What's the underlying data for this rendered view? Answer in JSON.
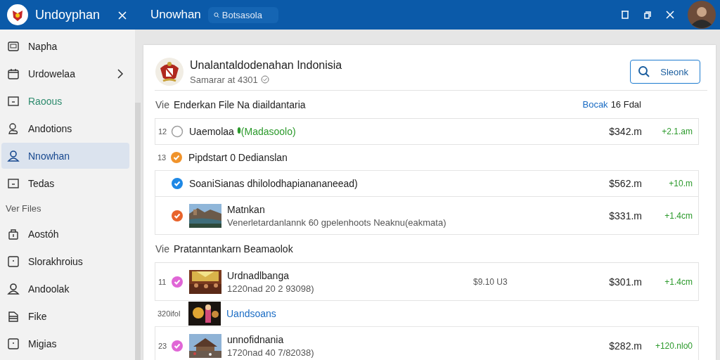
{
  "topbar": {
    "app_title": "Undoyphan",
    "section_title": "Unowhan",
    "search": {
      "placeholder": "Botsasola"
    }
  },
  "sidebar": {
    "items": [
      {
        "label": "Napha",
        "selected": false,
        "chevron": false
      },
      {
        "label": "Urdowelaa",
        "selected": false,
        "chevron": true
      },
      {
        "label": "Raoous",
        "selected": false,
        "chevron": false,
        "accent": true
      },
      {
        "label": "Andotions",
        "selected": false,
        "chevron": false
      },
      {
        "label": "Nnowhan",
        "selected": true,
        "chevron": false
      },
      {
        "label": "Tedas",
        "selected": false,
        "chevron": false
      }
    ],
    "section": "Ver Files",
    "items2": [
      {
        "label": "Aostóh",
        "selected": false,
        "chevron": false
      },
      {
        "label": "Slorakhroius",
        "selected": false,
        "chevron": false
      },
      {
        "label": "Andoolak",
        "selected": false,
        "chevron": false
      },
      {
        "label": "Fike",
        "selected": false,
        "chevron": false
      },
      {
        "label": "Migias",
        "selected": false,
        "chevron": false
      }
    ]
  },
  "card": {
    "title": "Unalantaldodenahan Indonisia",
    "subtitle": "Samarar at 4301",
    "button": "Sleonk",
    "sections": [
      {
        "prefix": "Vie",
        "title": "Enderkan File Na diaildantaria",
        "right_link": "Bocak",
        "right_text": "16 Fdal",
        "rows": [
          {
            "number": "12",
            "check": {
              "checked": false,
              "color": "#9e9e9e"
            },
            "title": "Uaemolaa",
            "tag": "(Madasoolo)",
            "price": "$342.m",
            "change": "+2.1.am",
            "boxed": true
          },
          {
            "number": "13",
            "check": {
              "checked": true,
              "color": "#f0932b"
            },
            "title": "Pipdstart 0 Dedianslan",
            "boxed": false
          },
          {
            "check": {
              "checked": true,
              "color": "#1e88e5"
            },
            "title": "SoaniSianas dhilolodhapianananeead)",
            "price": "$562.m",
            "change": "+10.m",
            "boxed": true
          },
          {
            "check": {
              "checked": true,
              "color": "#e8632b"
            },
            "title": "Matnkan",
            "subtitle": "Venerletardanlannk 60 gpelenhoots Neaknu(eakmata)",
            "price": "$331.m",
            "change": "+1.4cm",
            "boxed": true
          }
        ]
      },
      {
        "prefix": "Vie",
        "title": "Pratanntankarn Beamaolok",
        "rows": [
          {
            "number": "11",
            "check": {
              "checked": true,
              "color": "#e066d6"
            },
            "title": "Urdnadlbanga",
            "subtitle": "1220nad 20 2 93098)",
            "middle": "$9.10 U3",
            "price": "$301.m",
            "change": "+1.4cm",
            "boxed": true
          },
          {
            "number": "320ifol",
            "title": "Uandsoans",
            "link": true,
            "boxed": false
          },
          {
            "number": "23",
            "check": {
              "checked": true,
              "color": "#e066d6"
            },
            "title": "unnofidnania",
            "subtitle": "1720nad 40 7/82038)",
            "price": "$282.m",
            "change": "+120.nlo0",
            "boxed": true
          }
        ]
      }
    ]
  }
}
